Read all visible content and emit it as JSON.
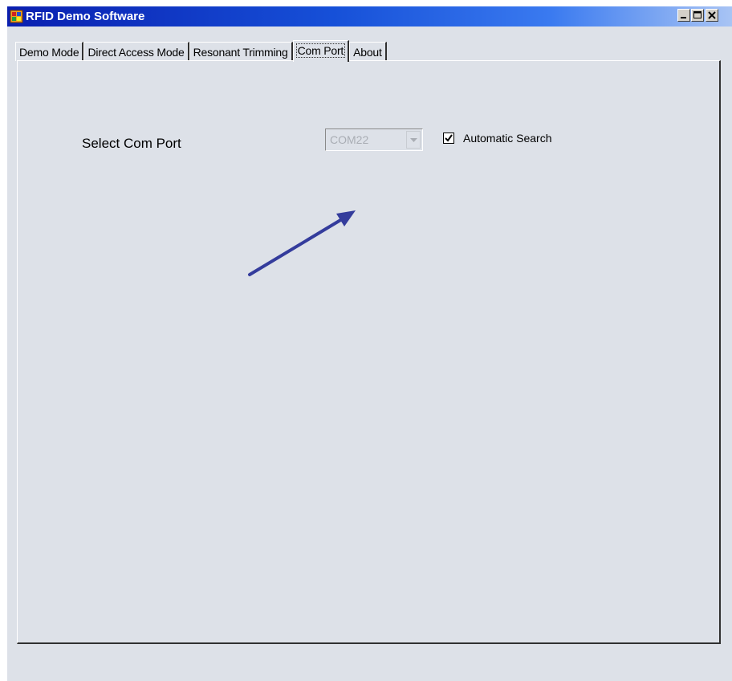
{
  "window": {
    "title": "RFID Demo Software"
  },
  "tabs": [
    {
      "label": "Demo Mode",
      "active": false
    },
    {
      "label": "Direct Access Mode",
      "active": false
    },
    {
      "label": "Resonant Trimming",
      "active": false
    },
    {
      "label": "Com Port",
      "active": true
    },
    {
      "label": "About",
      "active": false
    }
  ],
  "com_port": {
    "label": "Select Com Port",
    "selected_value": "COM22",
    "enabled": false,
    "automatic_search_label": "Automatic Search",
    "automatic_search_checked": true
  },
  "colors": {
    "titlebar_start": "#0a1fb0",
    "titlebar_end": "#a8c4f4",
    "arrow": "#343c9c",
    "panel_bg": "#dde1e8"
  },
  "icons": [
    "app-icon",
    "minimize-icon",
    "maximize-icon",
    "close-icon",
    "chevron-down-icon",
    "checkmark-icon",
    "arrow-annotation-icon"
  ]
}
